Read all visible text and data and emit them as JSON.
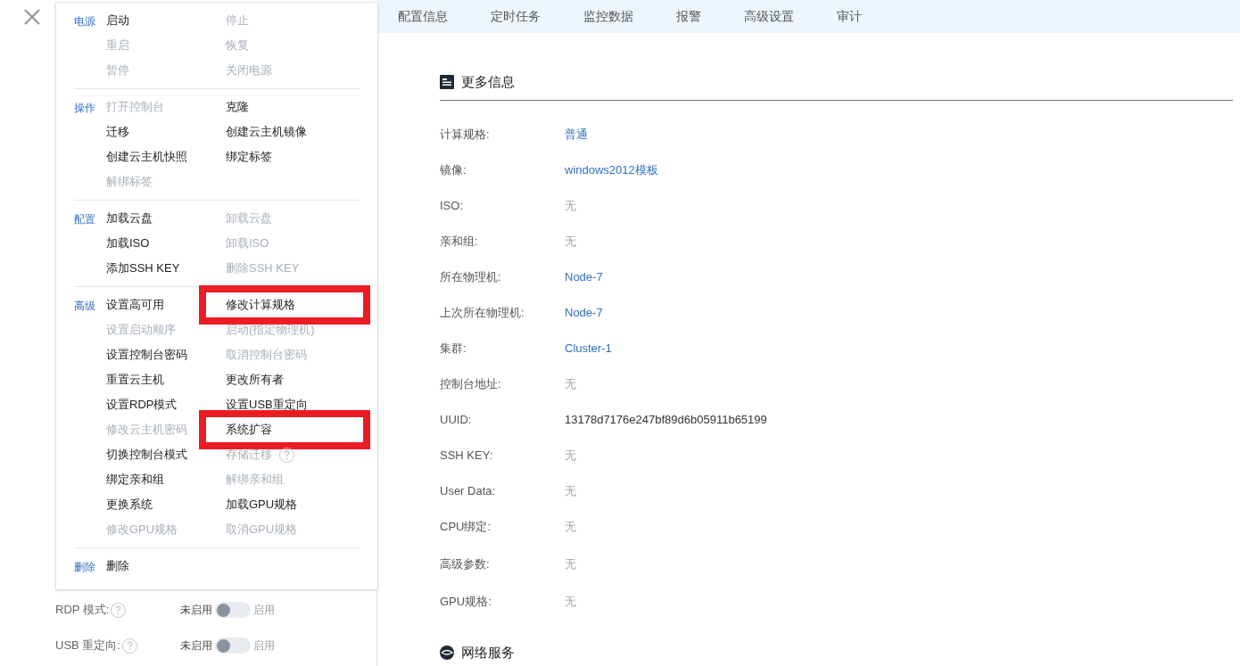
{
  "tabs": [
    {
      "label": "配置信息",
      "selected": false
    },
    {
      "label": "定时任务",
      "selected": false
    },
    {
      "label": "监控数据",
      "selected": false
    },
    {
      "label": "报警",
      "selected": false
    },
    {
      "label": "高级设置",
      "selected": false
    },
    {
      "label": "审计",
      "selected": false
    }
  ],
  "more_info": {
    "title": "更多信息",
    "rows": [
      {
        "label": "计算规格:",
        "value": "普通",
        "kind": "link"
      },
      {
        "label": "镜像:",
        "value": "windows2012模板",
        "kind": "link"
      },
      {
        "label": "ISO:",
        "value": "无",
        "kind": "none"
      },
      {
        "label": "亲和组:",
        "value": "无",
        "kind": "none"
      },
      {
        "label": "所在物理机:",
        "value": "Node-7",
        "kind": "link"
      },
      {
        "label": "上次所在物理机:",
        "value": "Node-7",
        "kind": "link"
      },
      {
        "label": "集群:",
        "value": "Cluster-1",
        "kind": "link"
      },
      {
        "label": "控制台地址:",
        "value": "无",
        "kind": "none"
      },
      {
        "label": "UUID:",
        "value": "13178d7176e247bf89d6b05911b65199",
        "kind": "text"
      },
      {
        "label": "SSH KEY:",
        "value": "无",
        "kind": "none"
      },
      {
        "label": "User Data:",
        "value": "无",
        "kind": "none"
      },
      {
        "label": "CPU绑定:",
        "value": "无",
        "kind": "none"
      },
      {
        "label": "高级参数:",
        "value": "无",
        "kind": "none"
      },
      {
        "label": "GPU规格:",
        "value": "无",
        "kind": "none"
      }
    ]
  },
  "network_title": "网络服务",
  "settings": [
    {
      "label": "RDP 模式:",
      "off_label": "未启用",
      "on_label": "启用",
      "on": false
    },
    {
      "label": "USB 重定向:",
      "off_label": "未启用",
      "on_label": "启用",
      "on": false
    }
  ],
  "menu": [
    {
      "label": "电源",
      "items": [
        {
          "label": "启动",
          "disabled": false
        },
        {
          "label": "停止",
          "disabled": true
        },
        {
          "label": "重启",
          "disabled": true
        },
        {
          "label": "恢复",
          "disabled": true
        },
        {
          "label": "暂停",
          "disabled": true
        },
        {
          "label": "关闭电源",
          "disabled": true
        }
      ]
    },
    {
      "label": "操作",
      "items": [
        {
          "label": "打开控制台",
          "disabled": true
        },
        {
          "label": "克隆",
          "disabled": false
        },
        {
          "label": "迁移",
          "disabled": false
        },
        {
          "label": "创建云主机镜像",
          "disabled": false
        },
        {
          "label": "创建云主机快照",
          "disabled": false
        },
        {
          "label": "绑定标签",
          "disabled": false
        },
        {
          "label": "解绑标签",
          "disabled": true
        }
      ]
    },
    {
      "label": "配置",
      "items": [
        {
          "label": "加载云盘",
          "disabled": false
        },
        {
          "label": "卸载云盘",
          "disabled": true
        },
        {
          "label": "加载ISO",
          "disabled": false
        },
        {
          "label": "卸载ISO",
          "disabled": true
        },
        {
          "label": "添加SSH KEY",
          "disabled": false
        },
        {
          "label": "删除SSH KEY",
          "disabled": true
        }
      ]
    },
    {
      "label": "高级",
      "items": [
        {
          "label": "设置高可用",
          "disabled": false
        },
        {
          "label": "修改计算规格",
          "disabled": false,
          "highlighted": true
        },
        {
          "label": "设置启动顺序",
          "disabled": true
        },
        {
          "label": "启动(指定物理机)",
          "disabled": true
        },
        {
          "label": "设置控制台密码",
          "disabled": false
        },
        {
          "label": "取消控制台密码",
          "disabled": true
        },
        {
          "label": "重置云主机",
          "disabled": false
        },
        {
          "label": "更改所有者",
          "disabled": false
        },
        {
          "label": "设置RDP模式",
          "disabled": false
        },
        {
          "label": "设置USB重定向",
          "disabled": false
        },
        {
          "label": "修改云主机密码",
          "disabled": true
        },
        {
          "label": "系统扩容",
          "disabled": false,
          "highlighted": true
        },
        {
          "label": "切换控制台模式",
          "disabled": false
        },
        {
          "label": "存储迁移",
          "disabled": true,
          "help": true
        },
        {
          "label": "绑定亲和组",
          "disabled": false
        },
        {
          "label": "解绑亲和组",
          "disabled": true
        },
        {
          "label": "更换系统",
          "disabled": false
        },
        {
          "label": "加载GPU规格",
          "disabled": false
        },
        {
          "label": "修改GPU规格",
          "disabled": true
        },
        {
          "label": "取消GPU规格",
          "disabled": true
        }
      ]
    },
    {
      "label": "删除",
      "items": [
        {
          "label": "删除",
          "disabled": false
        }
      ]
    }
  ]
}
